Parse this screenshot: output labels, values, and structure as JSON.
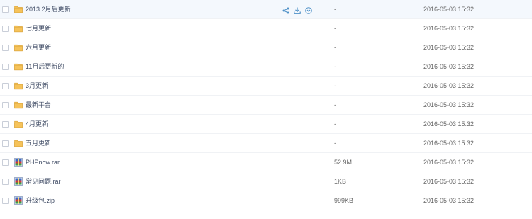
{
  "colors": {
    "folder": "#f6c35a",
    "action_icon": "#4e90c7",
    "hover_row": "#f4f8fd",
    "row_border": "#f0f2f5"
  },
  "hover_actions": [
    {
      "name": "share-icon"
    },
    {
      "name": "download-icon"
    },
    {
      "name": "more-dropdown-icon"
    }
  ],
  "files": [
    {
      "type": "folder",
      "name": "2013.2月后更新",
      "size": "-",
      "date": "2016-05-03 15:32",
      "hover": true
    },
    {
      "type": "folder",
      "name": "七月更新",
      "size": "-",
      "date": "2016-05-03 15:32"
    },
    {
      "type": "folder",
      "name": "六月更新",
      "size": "-",
      "date": "2016-05-03 15:32"
    },
    {
      "type": "folder",
      "name": "11月后更新的",
      "size": "-",
      "date": "2016-05-03 15:32"
    },
    {
      "type": "folder",
      "name": "3月更新",
      "size": "-",
      "date": "2016-05-03 15:32"
    },
    {
      "type": "folder",
      "name": "最新平台",
      "size": "-",
      "date": "2016-05-03 15:32"
    },
    {
      "type": "folder",
      "name": "4月更新",
      "size": "-",
      "date": "2016-05-03 15:32"
    },
    {
      "type": "folder",
      "name": "五月更新",
      "size": "-",
      "date": "2016-05-03 15:32"
    },
    {
      "type": "archive",
      "name": "PHPnow.rar",
      "size": "52.9M",
      "date": "2016-05-03 15:32"
    },
    {
      "type": "archive",
      "name": "常见问题.rar",
      "size": "1KB",
      "date": "2016-05-03 15:32"
    },
    {
      "type": "archive",
      "name": "升级包.zip",
      "size": "999KB",
      "date": "2016-05-03 15:32"
    }
  ]
}
